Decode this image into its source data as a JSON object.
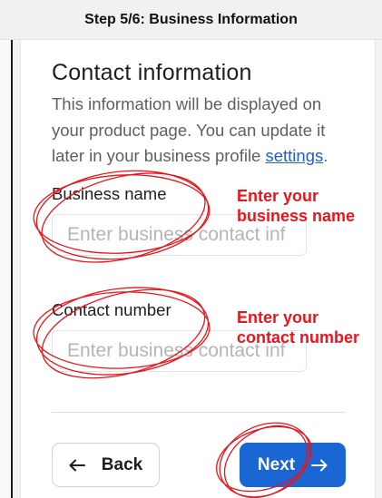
{
  "header": {
    "step_title": "Step 5/6: Business Information"
  },
  "form": {
    "title": "Contact information",
    "description_text": "This information will be displayed on your product page. You can update it later in your business profile ",
    "settings_link": "settings",
    "description_end": ".",
    "business_name": {
      "label": "Business name",
      "placeholder": "Enter business contact inf",
      "value": ""
    },
    "contact_number": {
      "label": "Contact number",
      "placeholder": "Enter business contact inf",
      "value": ""
    }
  },
  "annotations": {
    "business_name_hint": [
      "Enter your",
      "business name"
    ],
    "contact_number_hint": [
      "Enter your",
      "contact number"
    ],
    "color": "#e8151b"
  },
  "footer": {
    "back_label": "Back",
    "next_label": "Next",
    "back_icon": "arrow-left-icon",
    "next_icon": "arrow-right-icon"
  },
  "colors": {
    "primary": "#1a66d2",
    "link": "#1f5fc9",
    "annotation": "#e8151b"
  }
}
